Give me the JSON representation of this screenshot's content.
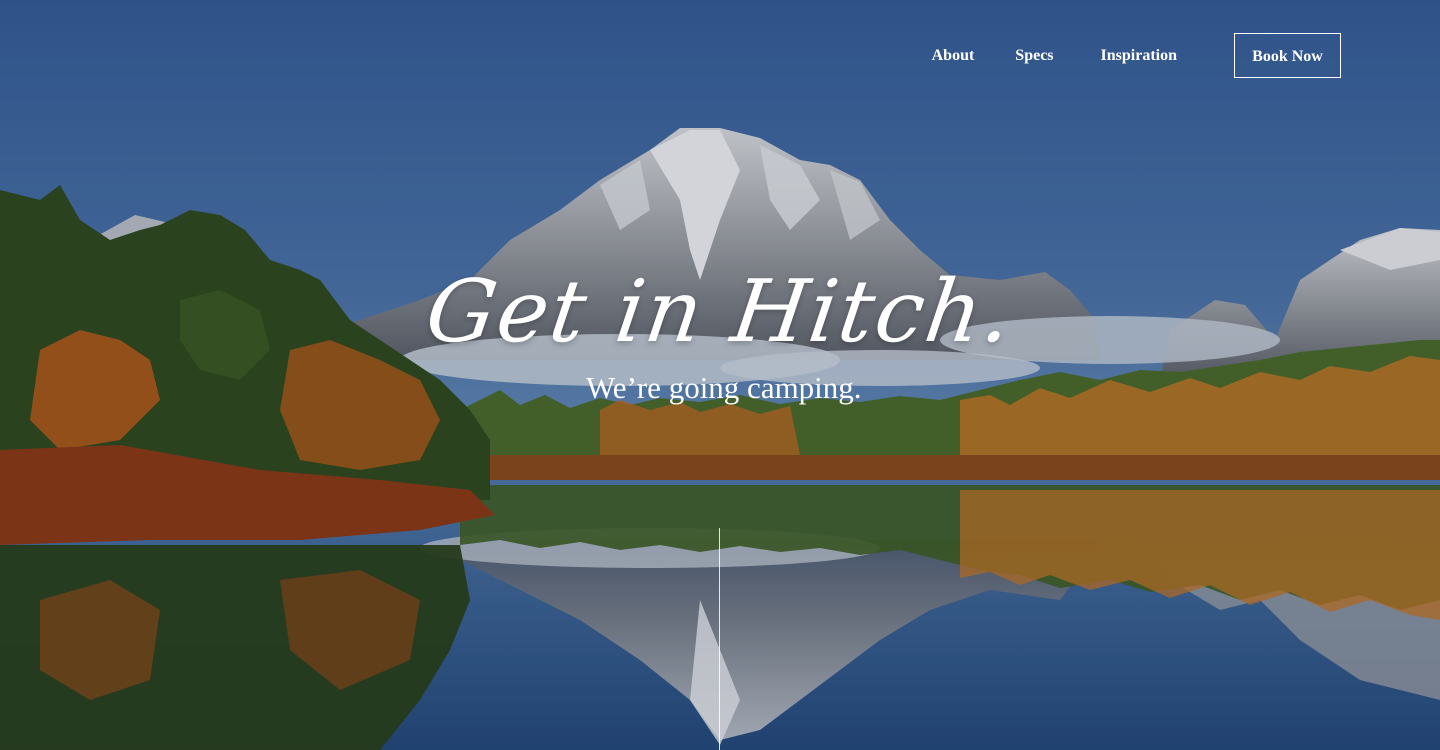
{
  "nav": {
    "items": [
      {
        "label": "About"
      },
      {
        "label": "Specs"
      },
      {
        "label": "Inspiration"
      }
    ],
    "cta_label": "Book Now"
  },
  "hero": {
    "headline": "Get in Hitch.",
    "tagline": "We’re going camping."
  },
  "colors": {
    "sky_top": "#3a629a",
    "sky_bottom": "#5a82b2",
    "water": "#2d5583",
    "foliage_orange": "#c26a1e",
    "foliage_green": "#3c5a22",
    "text": "#ffffff"
  }
}
